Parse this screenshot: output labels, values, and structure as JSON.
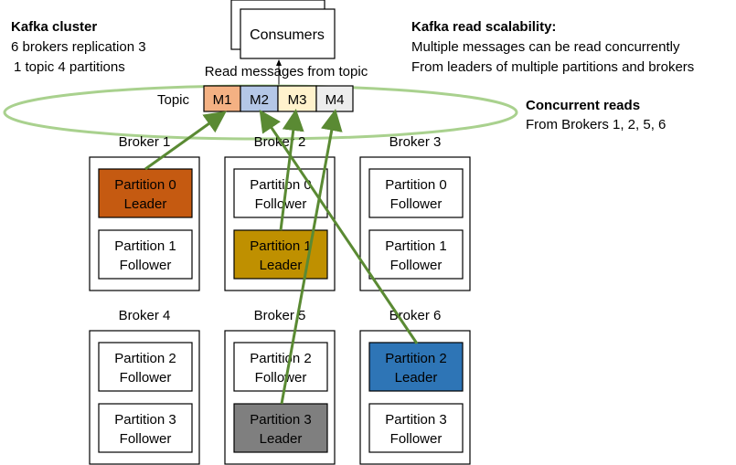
{
  "cluster": {
    "title": "Kafka cluster",
    "line1": "6 brokers replication 3",
    "line2": "1 topic 4 partitions"
  },
  "scalability": {
    "title": "Kafka read scalability:",
    "line1": "Multiple messages can be read concurrently",
    "line2": "From leaders of multiple partitions and brokers"
  },
  "concurrent": {
    "title": "Concurrent reads",
    "line1": "From Brokers 1, 2, 5, 6"
  },
  "consumers": {
    "label": "Consumers",
    "read_label": "Read messages from topic"
  },
  "topic": {
    "label": "Topic",
    "messages": [
      {
        "label": "M1",
        "color": "#f4b183"
      },
      {
        "label": "M2",
        "color": "#b4c7e7"
      },
      {
        "label": "M3",
        "color": "#fff2cc"
      },
      {
        "label": "M4",
        "color": "#ededed"
      }
    ]
  },
  "brokers": [
    {
      "name": "Broker 1",
      "partitions": [
        {
          "name": "Partition 0",
          "role": "Leader",
          "color": "#c55a11"
        },
        {
          "name": "Partition 1",
          "role": "Follower"
        }
      ]
    },
    {
      "name": "Broker 2",
      "partitions": [
        {
          "name": "Partition 0",
          "role": "Follower"
        },
        {
          "name": "Partition 1",
          "role": "Leader",
          "color": "#bf9000"
        }
      ]
    },
    {
      "name": "Broker 3",
      "partitions": [
        {
          "name": "Partition 0",
          "role": "Follower"
        },
        {
          "name": "Partition 1",
          "role": "Follower"
        }
      ]
    },
    {
      "name": "Broker 4",
      "partitions": [
        {
          "name": "Partition 2",
          "role": "Follower"
        },
        {
          "name": "Partition 3",
          "role": "Follower"
        }
      ]
    },
    {
      "name": "Broker 5",
      "partitions": [
        {
          "name": "Partition 2",
          "role": "Follower"
        },
        {
          "name": "Partition 3",
          "role": "Leader",
          "color": "#7f7f7f"
        }
      ]
    },
    {
      "name": "Broker 6",
      "partitions": [
        {
          "name": "Partition 2",
          "role": "Leader",
          "color": "#2e75b6"
        },
        {
          "name": "Partition 3",
          "role": "Follower"
        }
      ]
    }
  ]
}
